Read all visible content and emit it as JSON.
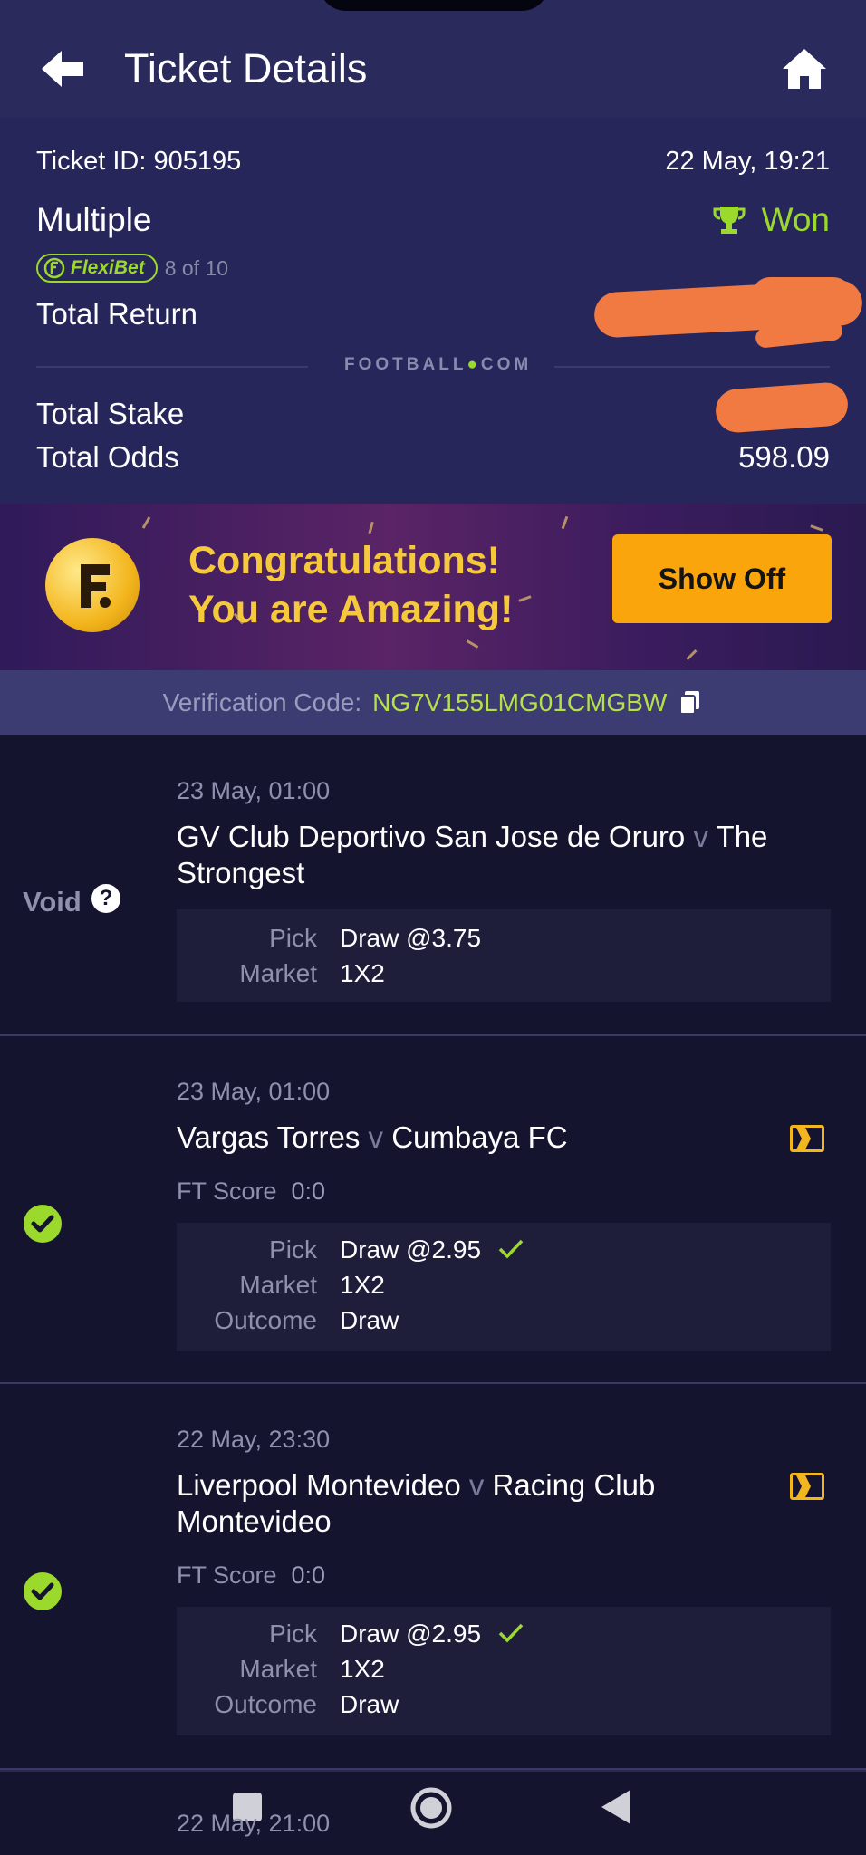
{
  "header": {
    "title": "Ticket Details",
    "back_icon": "arrow-left-icon",
    "home_icon": "home-icon"
  },
  "ticket": {
    "id_label": "Ticket ID: 905195",
    "date": "22 May, 19:21",
    "type": "Multiple",
    "status": "Won",
    "flexibet_label": "FlexiBet",
    "flexibet_count": "8 of 10",
    "total_return_label": "Total Return",
    "brand": "FOOTBALL",
    "brand_suffix": "COM",
    "total_stake_label": "Total Stake",
    "total_odds_label": "Total Odds",
    "total_odds_value": "598.09"
  },
  "banner": {
    "line1": "Congratulations!",
    "line2": "You are Amazing!",
    "button": "Show Off"
  },
  "verification": {
    "label": "Verification Code:",
    "code": "NG7V155LMG01CMGBW"
  },
  "matches": [
    {
      "status": "Void",
      "date": "23 May, 01:00",
      "home": "GV Club Deportivo San Jose de Oruro",
      "vs": "v",
      "away": "The Strongest",
      "pick_label": "Pick",
      "pick": "Draw @3.75",
      "market_label": "Market",
      "market": "1X2"
    },
    {
      "status": "won",
      "date": "23 May, 01:00",
      "home": "Vargas Torres",
      "vs": "v",
      "away": "Cumbaya FC",
      "score_label": "FT Score",
      "score": "0:0",
      "pick_label": "Pick",
      "pick": "Draw @2.95",
      "market_label": "Market",
      "market": "1X2",
      "outcome_label": "Outcome",
      "outcome": "Draw"
    },
    {
      "status": "won",
      "date": "22 May, 23:30",
      "home": "Liverpool Montevideo",
      "vs": "v",
      "away": "Racing Club Montevideo",
      "score_label": "FT Score",
      "score": "0:0",
      "pick_label": "Pick",
      "pick": "Draw @2.95",
      "market_label": "Market",
      "market": "1X2",
      "outcome_label": "Outcome",
      "outcome": "Draw"
    },
    {
      "date": "22 May, 21:00"
    }
  ],
  "colors": {
    "accent_green": "#9bd92c",
    "header_bg": "#2b2a5c",
    "summary_bg": "#27265a",
    "button_orange": "#fba50c",
    "redaction": "#f07a42"
  }
}
